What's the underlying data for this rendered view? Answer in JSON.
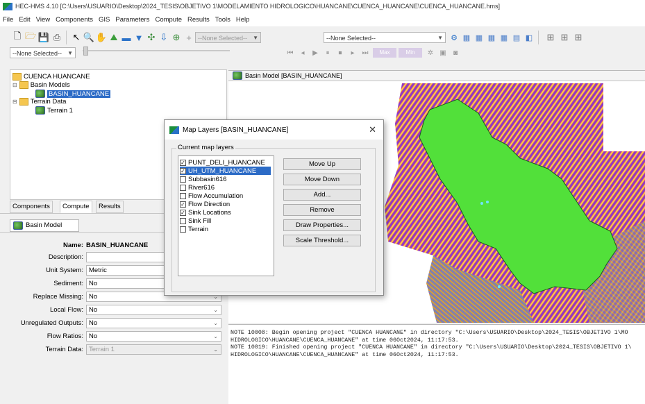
{
  "window": {
    "title": "HEC-HMS 4.10 [C:\\Users\\USUARIO\\Desktop\\2024_TESIS\\OBJETIVO 1\\MODELAMIENTO HIDROLOGICO\\HUANCANE\\CUENCA_HUANCANE\\CUENCA_HUANCANE.hms]"
  },
  "menu": [
    "File",
    "Edit",
    "View",
    "Components",
    "GIS",
    "Parameters",
    "Compute",
    "Results",
    "Tools",
    "Help"
  ],
  "toolbar": {
    "combo1": "--None Selected--",
    "combo2": "--None Selected--",
    "combo3": "--None Selected--",
    "plus_label": "+",
    "max_label": "Max",
    "min_label": "Min"
  },
  "tree": {
    "project": "CUENCA HUANCANE",
    "basin_models": "Basin Models",
    "basin": "BASIN_HUANCANE",
    "terrain_data": "Terrain Data",
    "terrain": "Terrain 1"
  },
  "tabs": [
    "Components",
    "Compute",
    "Results"
  ],
  "component_editor": {
    "tab": "Basin Model",
    "name_label": "Name:",
    "name_value": "BASIN_HUANCANE",
    "fields": [
      {
        "label": "Description:",
        "value": ""
      },
      {
        "label": "Unit System:",
        "value": "Metric"
      },
      {
        "label": "Sediment:",
        "value": "No"
      },
      {
        "label": "Replace Missing:",
        "value": "No"
      },
      {
        "label": "Local Flow:",
        "value": "No"
      },
      {
        "label": "Unregulated Outputs:",
        "value": "No"
      },
      {
        "label": "Flow Ratios:",
        "value": "No"
      },
      {
        "label": "Terrain Data:",
        "value": "Terrain 1"
      }
    ]
  },
  "map_window": {
    "title": "Basin Model [BASIN_HUANCANE]"
  },
  "messages": [
    "NOTE 10008:  Begin opening project \"CUENCA HUANCANE\" in directory \"C:\\Users\\USUARIO\\Desktop\\2024_TESIS\\OBJETIVO 1\\MO",
    "HIDROLOGICO\\HUANCANE\\CUENCA_HUANCANE\" at time 06Oct2024, 11:17:53.",
    "NOTE 10019:  Finished opening project \"CUENCA HUANCANE\" in directory \"C:\\Users\\USUARIO\\Desktop\\2024_TESIS\\OBJETIVO 1\\",
    "HIDROLOGICO\\HUANCANE\\CUENCA_HUANCANE\" at time 06Oct2024, 11:17:53."
  ],
  "dialog": {
    "title": "Map Layers [BASIN_HUANCANE]",
    "group_title": "Current map layers",
    "layers": [
      {
        "name": "PUNT_DELI_HUANCANE",
        "checked": true
      },
      {
        "name": "UH_UTM_HUANCANE",
        "checked": true
      },
      {
        "name": "Subbasin616",
        "checked": false
      },
      {
        "name": "River616",
        "checked": false
      },
      {
        "name": "Flow Accumulation",
        "checked": false
      },
      {
        "name": "Flow Direction",
        "checked": true
      },
      {
        "name": "Sink Locations",
        "checked": true
      },
      {
        "name": "Sink Fill",
        "checked": false
      },
      {
        "name": "Terrain",
        "checked": false
      }
    ],
    "buttons": [
      "Move Up",
      "Move Down",
      "Add...",
      "Remove",
      "Draw Properties...",
      "Scale Threshold..."
    ]
  }
}
